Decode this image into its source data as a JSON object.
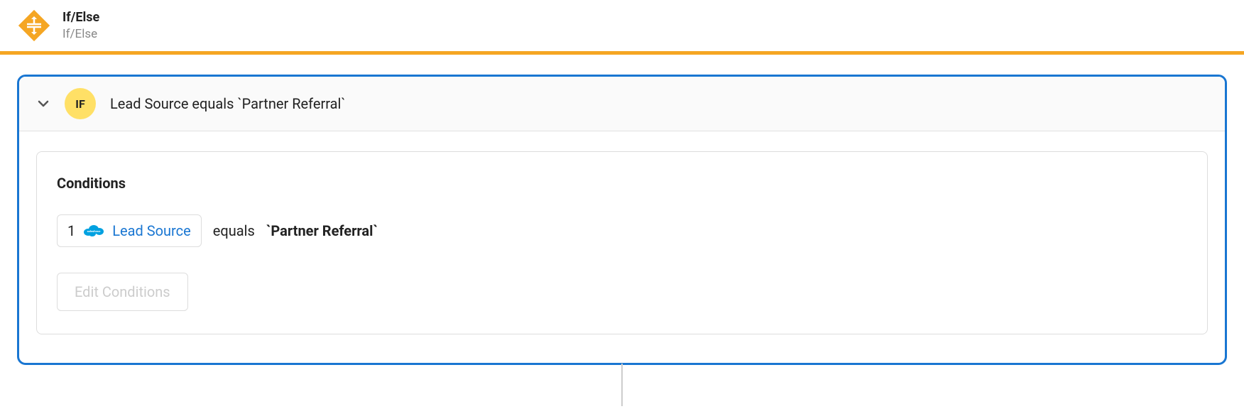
{
  "header": {
    "title": "If/Else",
    "subtitle": "If/Else"
  },
  "panel": {
    "badge": "IF",
    "summary": "Lead Source equals `Partner Referral`"
  },
  "conditions": {
    "title": "Conditions",
    "items": [
      {
        "number": "1",
        "field": "Lead Source",
        "operator": "equals",
        "value": "`Partner Referral`"
      }
    ],
    "editButton": "Edit Conditions"
  }
}
